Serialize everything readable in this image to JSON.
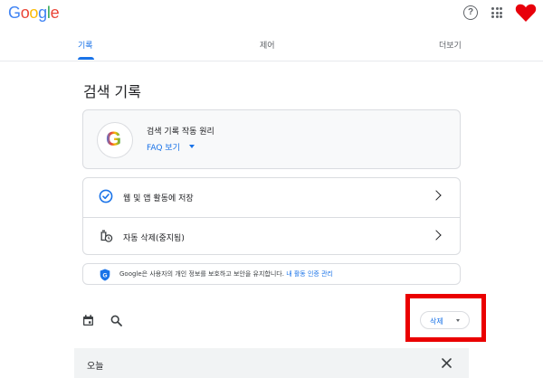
{
  "header": {
    "logo_letters": [
      "G",
      "o",
      "o",
      "g",
      "l",
      "e"
    ],
    "logo_colors": [
      "#4285F4",
      "#EA4335",
      "#FBBC05",
      "#4285F4",
      "#34A853",
      "#EA4335"
    ],
    "help_glyph": "?",
    "icons": [
      "help-icon",
      "apps-icon",
      "heart-avatar-icon"
    ],
    "avatar_color": "#e8000b"
  },
  "tabs": [
    {
      "label": "기록",
      "active": true
    },
    {
      "label": "제어",
      "active": false
    },
    {
      "label": "더보기",
      "active": false
    }
  ],
  "page": {
    "title": "검색 기록"
  },
  "info_card": {
    "title": "검색 기록 작동 원리",
    "link_label": "FAQ 보기",
    "g_letter": "G"
  },
  "settings": [
    {
      "label": "웹 및 앱 활동에 저장",
      "icon": "check-circle-icon"
    },
    {
      "label": "자동 삭제(중지됨)",
      "icon": "auto-delete-icon"
    }
  ],
  "privacy": {
    "text": "Google은 사용자의 개인 정보를 보호하고 보안을 유지합니다.",
    "link_label": "내 활동 인증 관리",
    "shield_letter": "G"
  },
  "toolbar": {
    "delete_label": "삭제",
    "icons": [
      "calendar-icon",
      "search-icon"
    ]
  },
  "colors": {
    "accent": "#1a73e8",
    "highlight": "#ea0000"
  },
  "history": {
    "group_label": "오늘"
  }
}
